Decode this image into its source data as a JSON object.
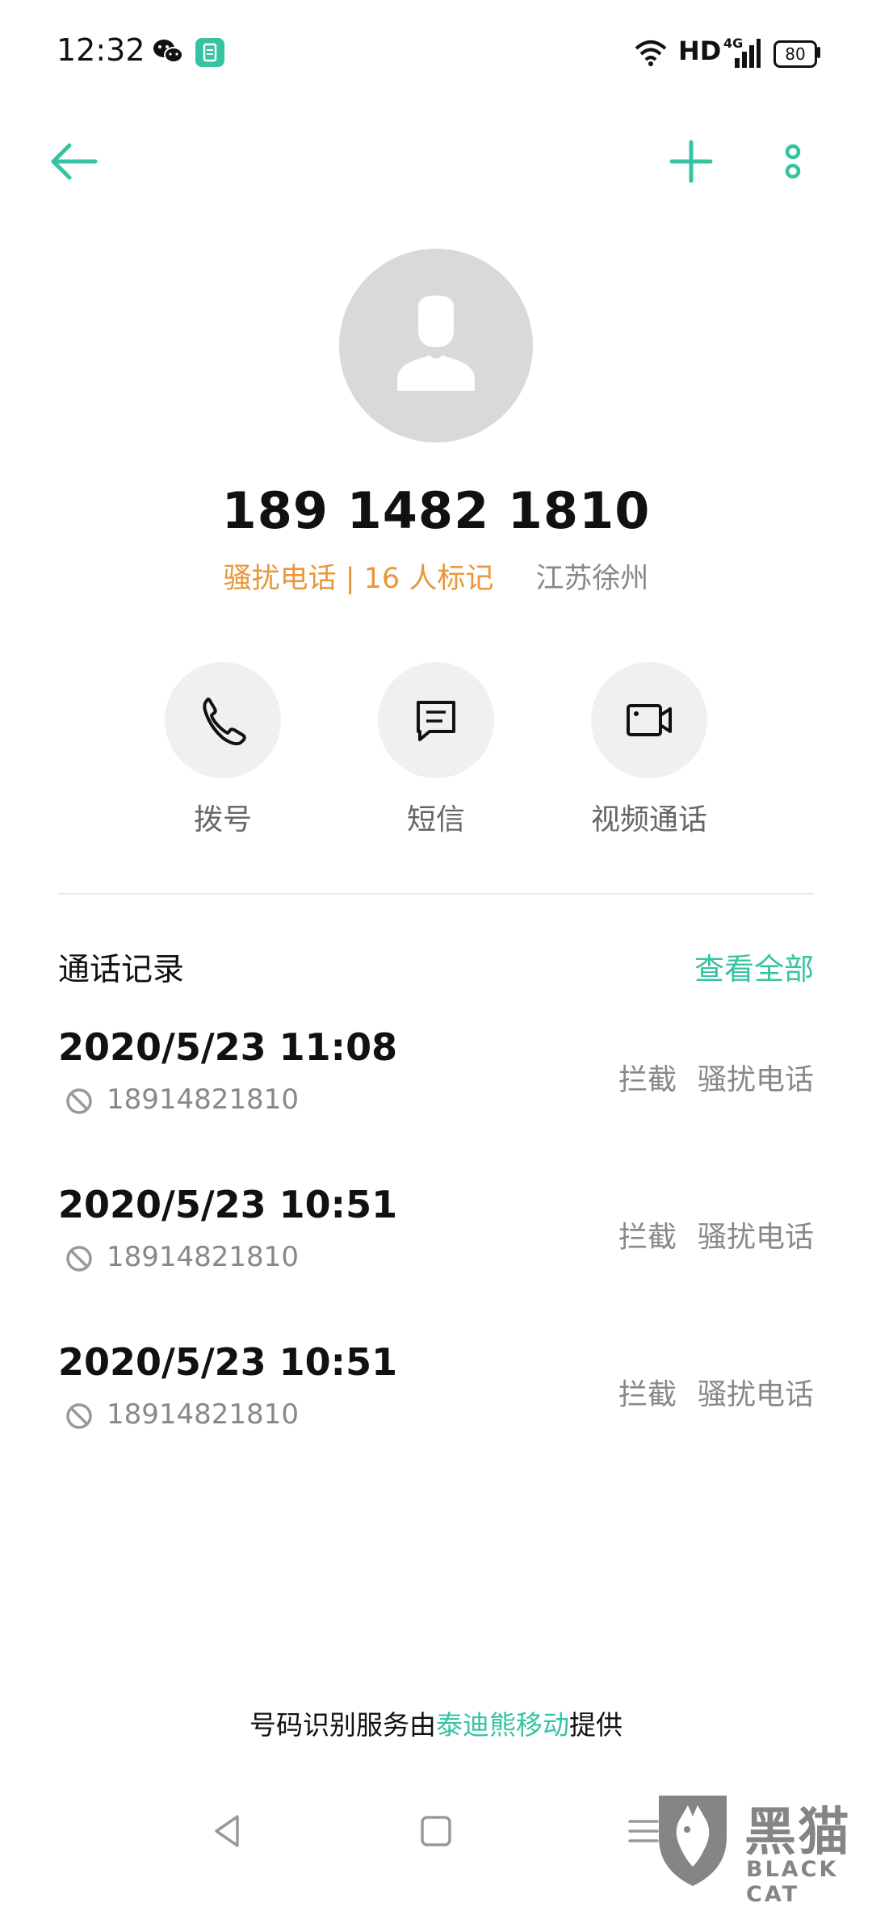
{
  "status_bar": {
    "time": "12:32",
    "network_label": "HD",
    "network_type": "4G",
    "battery": "80",
    "icons": [
      "wechat-icon",
      "app-icon",
      "wifi-icon",
      "signal-icon",
      "battery-icon"
    ]
  },
  "toolbar": {
    "icons": [
      "back-arrow-icon",
      "plus-icon",
      "more-vertical-icon"
    ]
  },
  "contact": {
    "avatar_icon": "person-icon",
    "number": "189 1482 1810",
    "spam_tag": "骚扰电话 | 16 人标记",
    "location": "江苏徐州"
  },
  "actions": [
    {
      "label": "拨号",
      "icon": "phone-icon"
    },
    {
      "label": "短信",
      "icon": "message-icon"
    },
    {
      "label": "视频通话",
      "icon": "video-icon"
    }
  ],
  "call_log": {
    "title": "通话记录",
    "view_all": "查看全部",
    "entries": [
      {
        "datetime": "2020/5/23 11:08",
        "number": "18914821810",
        "status": "拦截",
        "type": "骚扰电话"
      },
      {
        "datetime": "2020/5/23 10:51",
        "number": "18914821810",
        "status": "拦截",
        "type": "骚扰电话"
      },
      {
        "datetime": "2020/5/23 10:51",
        "number": "18914821810",
        "status": "拦截",
        "type": "骚扰电话"
      }
    ]
  },
  "footer": {
    "prefix": "号码识别服务由",
    "provider": "泰迪熊移动",
    "suffix": "提供"
  },
  "nav_bar": {
    "icons": [
      "nav-back-icon",
      "nav-home-icon",
      "nav-recents-icon"
    ]
  },
  "watermark": {
    "text_cn": "黑猫",
    "text_en": "BLACK CAT"
  },
  "colors": {
    "accent": "#35c3a2",
    "spam_orange": "#e8973a",
    "secondary_text": "#888888",
    "avatar_bg": "#d9d9d9",
    "action_bg": "#f0f0f0"
  }
}
